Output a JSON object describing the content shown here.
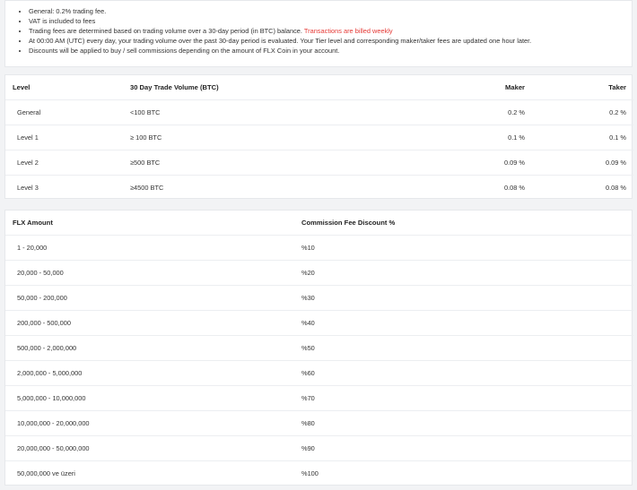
{
  "notes": [
    {
      "text": "General: 0.2% trading fee.",
      "highlight": ""
    },
    {
      "text": "VAT is included to fees",
      "highlight": ""
    },
    {
      "text": "Trading fees are determined based on trading volume over a 30-day period (in BTC) balance. ",
      "highlight": "Transactions are billed weekly"
    },
    {
      "text": "At 00:00 AM (UTC) every day, your trading volume over the past 30-day period is evaluated. Your Tier level and corresponding maker/taker fees are updated one hour later.",
      "highlight": ""
    },
    {
      "text": "Discounts will be applied to buy / sell commissions depending on the amount of FLX Coin in your account.",
      "highlight": ""
    }
  ],
  "fee_table": {
    "headers": {
      "level": "Level",
      "volume": "30 Day Trade Volume (BTC)",
      "maker": "Maker",
      "taker": "Taker"
    },
    "rows": [
      {
        "level": "General",
        "volume": "<100 BTC",
        "maker": "0.2 %",
        "taker": "0.2 %"
      },
      {
        "level": "Level 1",
        "volume": "≥ 100 BTC",
        "maker": "0.1 %",
        "taker": "0.1 %"
      },
      {
        "level": "Level 2",
        "volume": "≥500 BTC",
        "maker": "0.09 %",
        "taker": "0.09 %"
      },
      {
        "level": "Level 3",
        "volume": "≥4500 BTC",
        "maker": "0.08 %",
        "taker": "0.08 %"
      }
    ]
  },
  "discount_table": {
    "headers": {
      "amount": "FLX Amount",
      "discount": "Commission Fee Discount %"
    },
    "rows": [
      {
        "amount": "1 - 20,000",
        "discount": "%10"
      },
      {
        "amount": "20,000 - 50,000",
        "discount": "%20"
      },
      {
        "amount": "50,000 - 200,000",
        "discount": "%30"
      },
      {
        "amount": "200,000 - 500,000",
        "discount": "%40"
      },
      {
        "amount": "500,000 - 2,000,000",
        "discount": "%50"
      },
      {
        "amount": "2,000,000 - 5,000,000",
        "discount": "%60"
      },
      {
        "amount": "5,000,000 - 10,000,000",
        "discount": "%70"
      },
      {
        "amount": "10,000,000 - 20,000,000",
        "discount": "%80"
      },
      {
        "amount": "20,000,000 - 50,000,000",
        "discount": "%90"
      },
      {
        "amount": "50,000,000 ve üzeri",
        "discount": "%100"
      }
    ]
  }
}
